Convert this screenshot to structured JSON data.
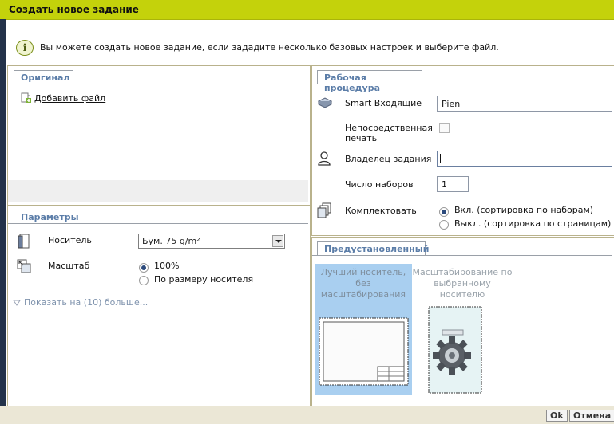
{
  "window": {
    "title": "Создать новое задание"
  },
  "info": {
    "text": "Вы можете создать новое задание, если зададите несколько базовых настроек и выберите файл."
  },
  "original": {
    "tab": "Оригинал",
    "add_file": "Добавить файл"
  },
  "params": {
    "tab": "Параметры",
    "media_label": "Носитель",
    "media_value": "Бум. 75 g/m²",
    "scale_label": "Масштаб",
    "scale_options": [
      {
        "label": "100%",
        "selected": true
      },
      {
        "label": "По размеру носителя",
        "selected": false
      }
    ],
    "show_more": "Показать на (10) больше..."
  },
  "workflow": {
    "tab": "Рабочая процедура",
    "smart_inbox_label": "Smart Входящие",
    "smart_inbox_value": "Pien",
    "direct_print_label_line1": "Непосредственная",
    "direct_print_label_line2": "печать",
    "owner_label": "Владелец задания",
    "owner_value": "",
    "copies_label": "Число наборов",
    "copies_value": "1",
    "collate_label": "Комплектовать",
    "collate_options": [
      {
        "label": "Вкл. (сортировка по наборам)",
        "selected": true
      },
      {
        "label": "Выкл. (сортировка по страницам)",
        "selected": false
      }
    ]
  },
  "presets": {
    "tab": "Предустановленный",
    "items": [
      {
        "line1": "Лучший носитель,",
        "line2": "без",
        "line3": "масштабирования",
        "selected": true
      },
      {
        "line1": "Масштабирование по",
        "line2": "выбранному",
        "line3": "носителю",
        "selected": false
      }
    ]
  },
  "footer": {
    "ok": "Ok",
    "cancel": "Отмена"
  },
  "colors": {
    "titlebar": "#c4d20b",
    "tab_text": "#5b7da8",
    "selected_preset": "#a9cff0",
    "footer": "#ebe7d6"
  }
}
